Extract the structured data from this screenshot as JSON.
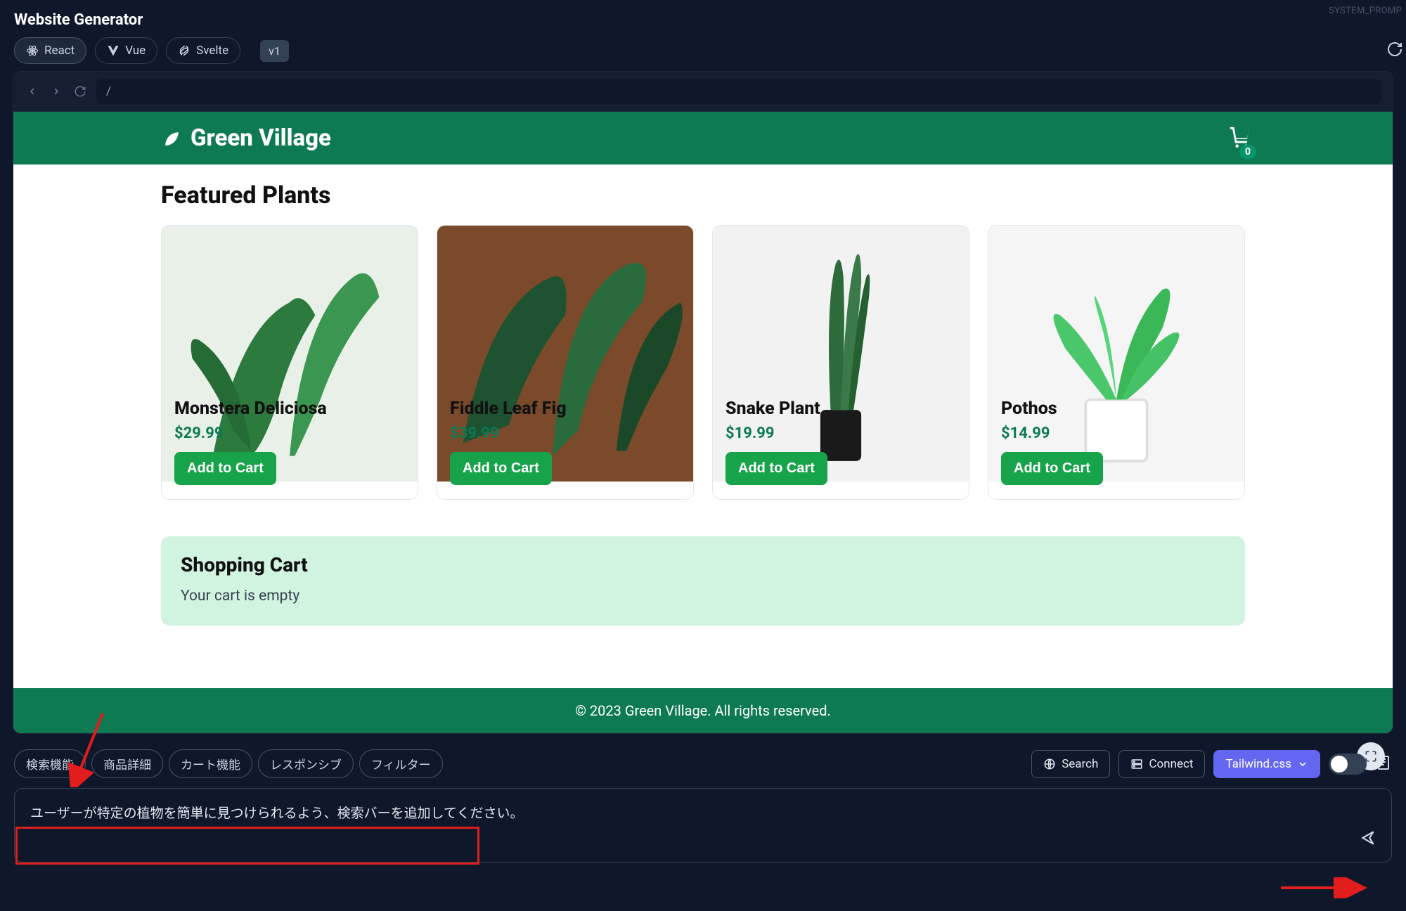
{
  "app": {
    "title": "Website Generator",
    "sys_prompt": "SYSTEM_PROMP",
    "frameworks": [
      "React",
      "Vue",
      "Svelte"
    ],
    "active_framework": 0,
    "version": "v1"
  },
  "browser": {
    "path": "/"
  },
  "site": {
    "brand": "Green Village",
    "cart_count": "0",
    "section_title": "Featured Plants",
    "products": [
      {
        "name": "Monstera Deliciosa",
        "price": "$29.99",
        "btn": "Add to Cart",
        "img_class": "plant-bg-1"
      },
      {
        "name": "Fiddle Leaf Fig",
        "price": "$39.99",
        "btn": "Add to Cart",
        "img_class": "plant-bg-2"
      },
      {
        "name": "Snake Plant",
        "price": "$19.99",
        "btn": "Add to Cart",
        "img_class": "plant-bg-3"
      },
      {
        "name": "Pothos",
        "price": "$14.99",
        "btn": "Add to Cart",
        "img_class": "plant-bg-4"
      }
    ],
    "cart_title": "Shopping Cart",
    "cart_empty": "Your cart is empty",
    "footer": "© 2023 Green Village. All rights reserved."
  },
  "suggestions": [
    "検索機能",
    "商品詳細",
    "カート機能",
    "レスポンシブ",
    "フィルター"
  ],
  "controls": {
    "search": "Search",
    "connect": "Connect",
    "css_framework": "Tailwind.css"
  },
  "prompt": {
    "text": "ユーザーが特定の植物を簡単に見つけられるよう、検索バーを追加してください。"
  }
}
